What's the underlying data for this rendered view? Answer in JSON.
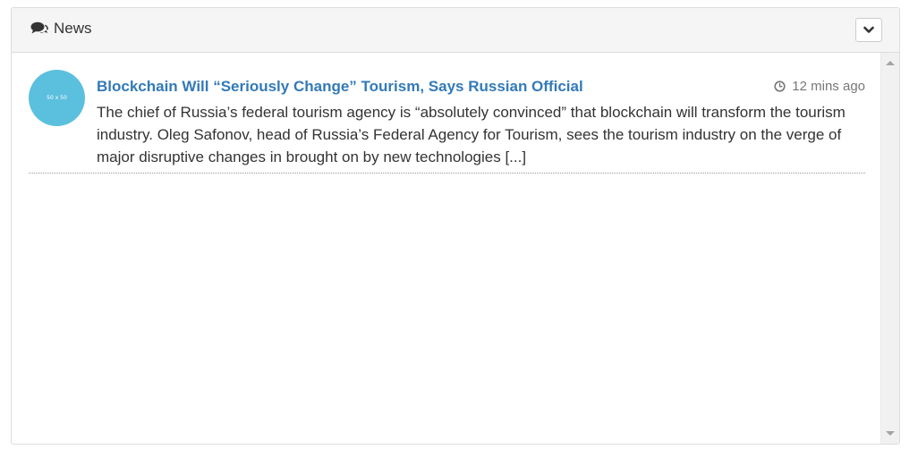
{
  "panel": {
    "title": "News"
  },
  "news_items": [
    {
      "thumbnail_text": "50 x 50",
      "title": "Blockchain Will “Seriously Change” Tourism, Says Russian Official",
      "time": "12 mins ago",
      "summary": "The chief of Russia’s federal tourism agency is “absolutely convinced” that blockchain will transform the tourism industry. Oleg Safonov, head of Russia’s Federal Agency for Tourism, sees the tourism industry on the verge of major disruptive changes in brought on by new technologies [...]"
    }
  ],
  "icons": {
    "header": "comments-icon",
    "collapse": "chevron-down-icon",
    "time": "clock-icon"
  },
  "colors": {
    "accent": "#337ab7",
    "thumbnail": "#5bc0de",
    "heading_bg": "#f5f5f5"
  }
}
